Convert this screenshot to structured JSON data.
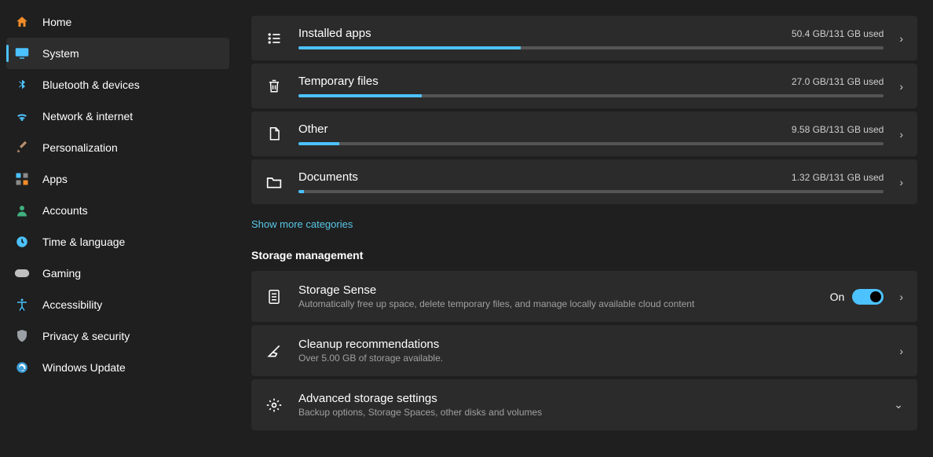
{
  "sidebar": {
    "items": [
      {
        "label": "Home"
      },
      {
        "label": "System"
      },
      {
        "label": "Bluetooth & devices"
      },
      {
        "label": "Network & internet"
      },
      {
        "label": "Personalization"
      },
      {
        "label": "Apps"
      },
      {
        "label": "Accounts"
      },
      {
        "label": "Time & language"
      },
      {
        "label": "Gaming"
      },
      {
        "label": "Accessibility"
      },
      {
        "label": "Privacy & security"
      },
      {
        "label": "Windows Update"
      }
    ]
  },
  "storage": {
    "items": [
      {
        "title": "Installed apps",
        "usage": "50.4 GB/131 GB used",
        "pct": 38
      },
      {
        "title": "Temporary files",
        "usage": "27.0 GB/131 GB used",
        "pct": 21
      },
      {
        "title": "Other",
        "usage": "9.58 GB/131 GB used",
        "pct": 7
      },
      {
        "title": "Documents",
        "usage": "1.32 GB/131 GB used",
        "pct": 1
      }
    ],
    "show_more": "Show more categories"
  },
  "management": {
    "heading": "Storage management",
    "sense": {
      "title": "Storage Sense",
      "sub": "Automatically free up space, delete temporary files, and manage locally available cloud content",
      "state": "On"
    },
    "cleanup": {
      "title": "Cleanup recommendations",
      "sub": "Over 5.00 GB of storage available."
    },
    "advanced": {
      "title": "Advanced storage settings",
      "sub": "Backup options, Storage Spaces, other disks and volumes"
    }
  }
}
